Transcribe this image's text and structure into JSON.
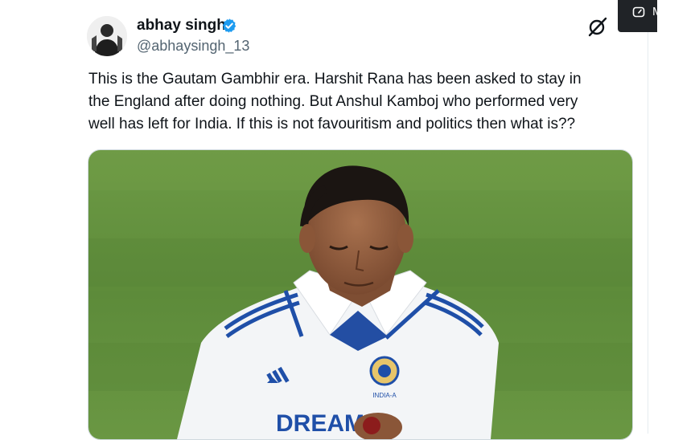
{
  "tweet": {
    "author": {
      "name": "abhay singh",
      "handle": "@abhaysingh_13",
      "verified": true
    },
    "text_lines": [
      "This is the Gautam Gambhir era. Harshit Rana has been asked to stay in",
      "the England after doing nothing. But Anshul Kamboj who performed very",
      "well has left for India. If this is not favouritism and politics then what is??"
    ],
    "media": {
      "jersey_text": "DREAM",
      "badge_text": "INDIA-A"
    }
  },
  "toolbar": {
    "grok_icon": "grok-icon",
    "more_icon": "more-icon",
    "overlay_label": "M"
  },
  "colors": {
    "verified_blue": "#1d9bf0",
    "handle_gray": "#536471",
    "pitch_green": "#5f8f3a",
    "jersey_blue": "#1f4fa8"
  }
}
